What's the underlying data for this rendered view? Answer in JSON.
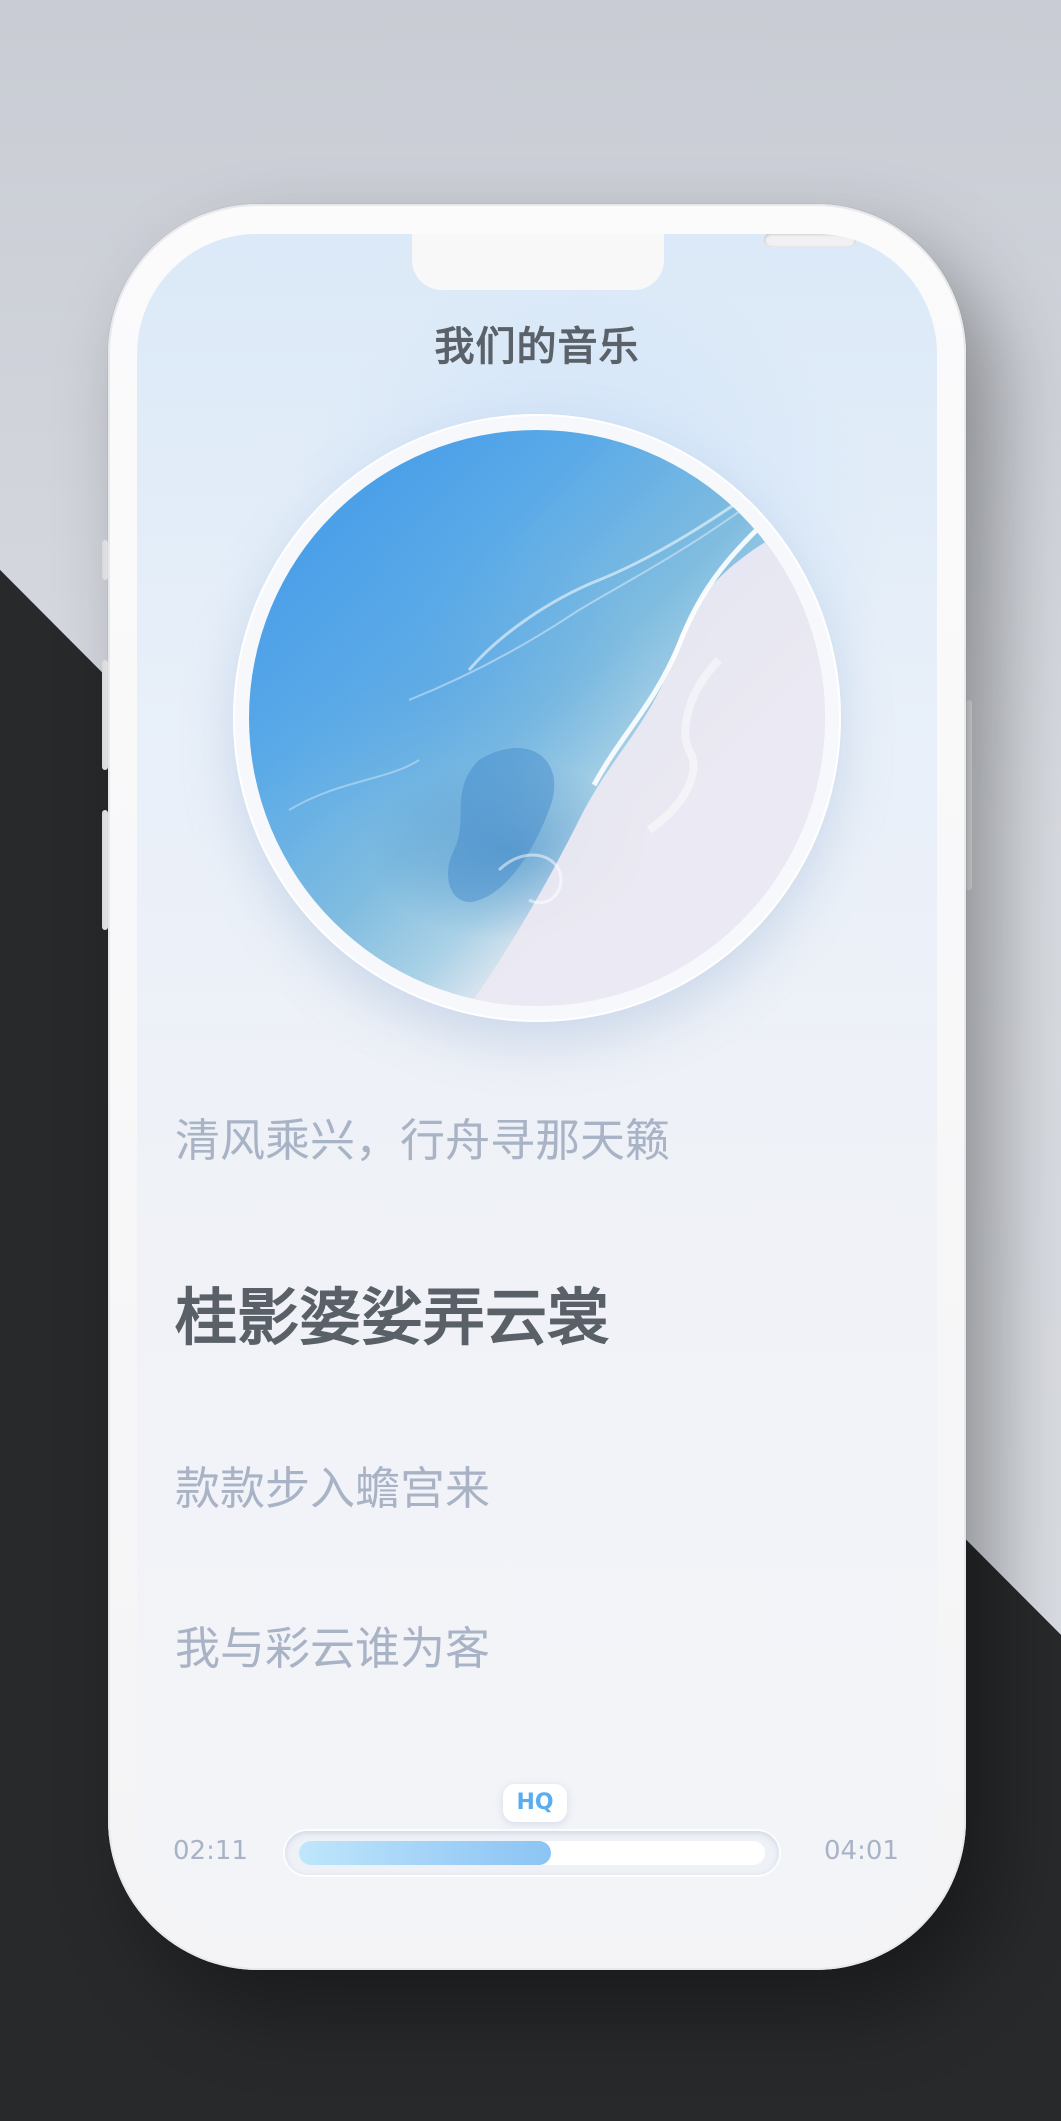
{
  "app": {
    "title": "我们的音乐"
  },
  "album": {
    "art_icon": "ocean-shore-artwork"
  },
  "lyrics": {
    "previous": "清风乘兴，行舟寻那天籁",
    "current": "桂影婆娑弄云裳",
    "next": "款款步入蟾宫来",
    "upcoming": "我与彩云谁为客"
  },
  "player": {
    "quality_badge": "HQ",
    "time_current": "02:11",
    "time_total": "04:01",
    "progress_fraction": 0.54
  },
  "colors": {
    "accent": "#5aaef0",
    "progress_fill": "#9fd0f7",
    "lyric_inactive": "#a9b3c6",
    "lyric_active": "#5a6068"
  }
}
